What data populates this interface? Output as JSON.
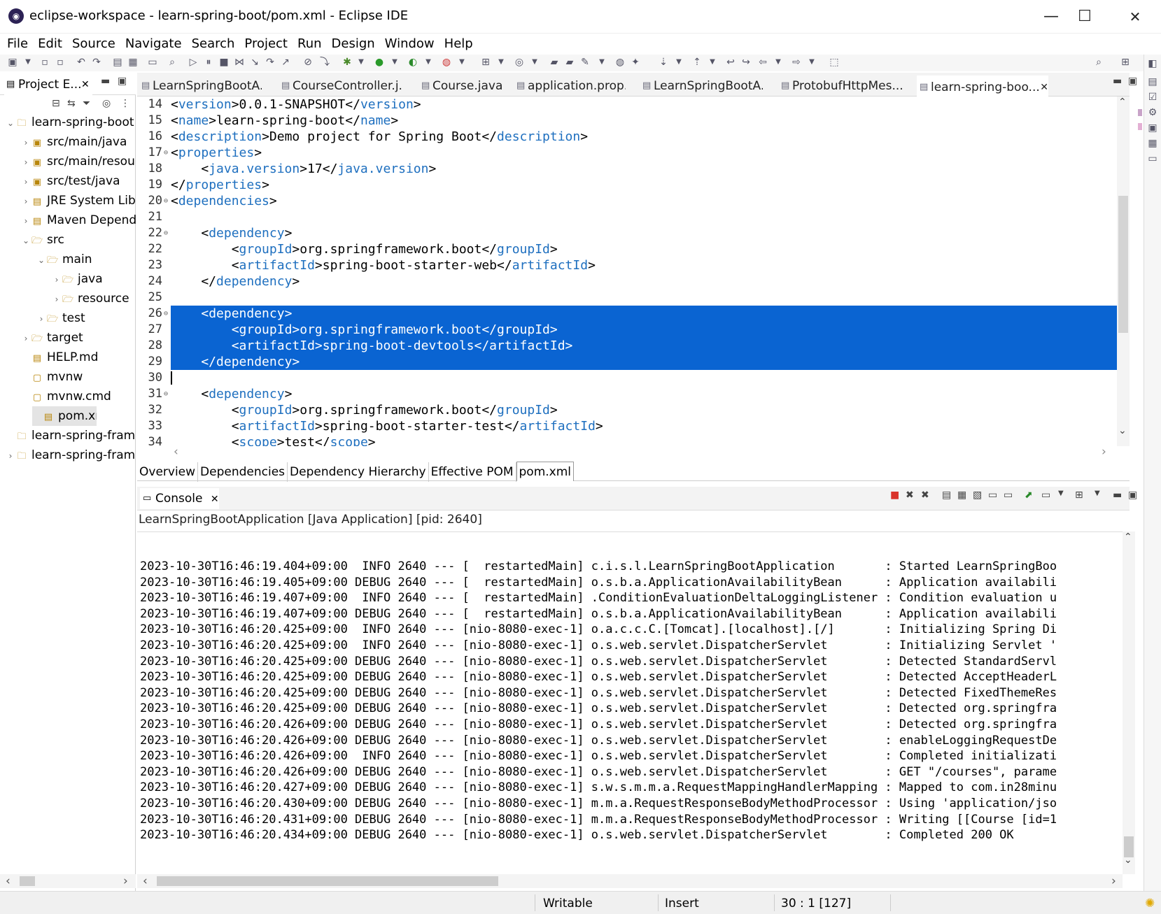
{
  "window": {
    "title": "eclipse-workspace - learn-spring-boot/pom.xml - Eclipse IDE",
    "minimize": "—",
    "maximize": "☐",
    "close": "✕"
  },
  "menu": [
    "File",
    "Edit",
    "Source",
    "Navigate",
    "Search",
    "Project",
    "Run",
    "Design",
    "Window",
    "Help"
  ],
  "project_explorer": {
    "tab_label": "Project E...",
    "tree": [
      {
        "label": "learn-spring-boot",
        "arrow": "⌄",
        "icon": "🗀"
      },
      {
        "label": "src/main/java",
        "arrow": "›",
        "icon": "▣"
      },
      {
        "label": "src/main/resou",
        "arrow": "›",
        "icon": "▣"
      },
      {
        "label": "src/test/java",
        "arrow": "›",
        "icon": "▣"
      },
      {
        "label": "JRE System Lib",
        "arrow": "›",
        "icon": "▤"
      },
      {
        "label": "Maven Depend",
        "arrow": "›",
        "icon": "▤"
      },
      {
        "label": "src",
        "arrow": "⌄",
        "icon": "🗁"
      },
      {
        "label": "main",
        "arrow": "⌄",
        "icon": "🗁"
      },
      {
        "label": "java",
        "arrow": "›",
        "icon": "🗁"
      },
      {
        "label": "resource",
        "arrow": "›",
        "icon": "🗁"
      },
      {
        "label": "test",
        "arrow": "›",
        "icon": "🗁"
      },
      {
        "label": "target",
        "arrow": "›",
        "icon": "🗁"
      },
      {
        "label": "HELP.md",
        "arrow": "",
        "icon": "▤"
      },
      {
        "label": "mvnw",
        "arrow": "",
        "icon": "▢"
      },
      {
        "label": "mvnw.cmd",
        "arrow": "",
        "icon": "▢"
      },
      {
        "label": "pom.xml",
        "arrow": "",
        "icon": "▤"
      },
      {
        "label": "learn-spring-frame",
        "arrow": "",
        "icon": "🗀"
      },
      {
        "label": "learn-spring-frame",
        "arrow": "›",
        "icon": "🗀"
      }
    ]
  },
  "editor_tabs": [
    "LearnSpringBootA...",
    "CourseController.j...",
    "Course.java",
    "application.prop...",
    "LearnSpringBootA...",
    "ProtobufHttpMes...",
    "learn-spring-boo..."
  ],
  "code_lines": [
    {
      "n": "14",
      "fold": "",
      "code": "<version>0.0.1-SNAPSHOT</version>"
    },
    {
      "n": "15",
      "fold": "",
      "code": "<name>learn-spring-boot</name>"
    },
    {
      "n": "16",
      "fold": "",
      "code": "<description>Demo project for Spring Boot</description>"
    },
    {
      "n": "17",
      "fold": "⊖",
      "code": "<properties>"
    },
    {
      "n": "18",
      "fold": "",
      "code": "    <java.version>17</java.version>"
    },
    {
      "n": "19",
      "fold": "",
      "code": "</properties>"
    },
    {
      "n": "20",
      "fold": "⊖",
      "code": "<dependencies>"
    },
    {
      "n": "21",
      "fold": "",
      "code": ""
    },
    {
      "n": "22",
      "fold": "⊖",
      "code": "    <dependency>"
    },
    {
      "n": "22",
      "fold": "",
      "code": "        <groupId>org.springframework.boot</groupId>"
    },
    {
      "n": "23",
      "fold": "",
      "code": "        <artifactId>spring-boot-starter-web</artifactId>"
    },
    {
      "n": "24",
      "fold": "",
      "code": "    </dependency>"
    },
    {
      "n": "25",
      "fold": "",
      "code": ""
    },
    {
      "n": "26",
      "fold": "⊖",
      "code": "    <dependency>"
    },
    {
      "n": "27",
      "fold": "",
      "code": "        <groupId>org.springframework.boot</groupId>"
    },
    {
      "n": "28",
      "fold": "",
      "code": "        <artifactId>spring-boot-devtools</artifactId>"
    },
    {
      "n": "29",
      "fold": "",
      "code": "    </dependency>"
    },
    {
      "n": "30",
      "fold": "",
      "code": ""
    },
    {
      "n": "31",
      "fold": "⊖",
      "code": "    <dependency>"
    },
    {
      "n": "32",
      "fold": "",
      "code": "        <groupId>org.springframework.boot</groupId>"
    },
    {
      "n": "33",
      "fold": "",
      "code": "        <artifactId>spring-boot-starter-test</artifactId>"
    },
    {
      "n": "34",
      "fold": "",
      "code": "        <scope>test</scope>"
    }
  ],
  "selected_lines": [
    "26",
    "27",
    "28",
    "29"
  ],
  "pom_tabs": [
    "Overview",
    "Dependencies",
    "Dependency Hierarchy",
    "Effective POM",
    "pom.xml"
  ],
  "console": {
    "tab_label": "Console",
    "process": "LearnSpringBootApplication [Java Application]   [pid: 2640]",
    "lines": [
      "2023-10-30T16:46:19.404+09:00  INFO 2640 --- [  restartedMain] c.i.s.l.LearnSpringBootApplication       : Started LearnSpringBoo",
      "2023-10-30T16:46:19.405+09:00 DEBUG 2640 --- [  restartedMain] o.s.b.a.ApplicationAvailabilityBean      : Application availabili",
      "2023-10-30T16:46:19.407+09:00  INFO 2640 --- [  restartedMain] .ConditionEvaluationDeltaLoggingListener : Condition evaluation u",
      "2023-10-30T16:46:19.407+09:00 DEBUG 2640 --- [  restartedMain] o.s.b.a.ApplicationAvailabilityBean      : Application availabili",
      "2023-10-30T16:46:20.425+09:00  INFO 2640 --- [nio-8080-exec-1] o.a.c.c.C.[Tomcat].[localhost].[/]       : Initializing Spring Di",
      "2023-10-30T16:46:20.425+09:00  INFO 2640 --- [nio-8080-exec-1] o.s.web.servlet.DispatcherServlet        : Initializing Servlet '",
      "2023-10-30T16:46:20.425+09:00 DEBUG 2640 --- [nio-8080-exec-1] o.s.web.servlet.DispatcherServlet        : Detected StandardServl",
      "2023-10-30T16:46:20.425+09:00 DEBUG 2640 --- [nio-8080-exec-1] o.s.web.servlet.DispatcherServlet        : Detected AcceptHeaderL",
      "2023-10-30T16:46:20.425+09:00 DEBUG 2640 --- [nio-8080-exec-1] o.s.web.servlet.DispatcherServlet        : Detected FixedThemeRes",
      "2023-10-30T16:46:20.425+09:00 DEBUG 2640 --- [nio-8080-exec-1] o.s.web.servlet.DispatcherServlet        : Detected org.springfra",
      "2023-10-30T16:46:20.426+09:00 DEBUG 2640 --- [nio-8080-exec-1] o.s.web.servlet.DispatcherServlet        : Detected org.springfra",
      "2023-10-30T16:46:20.426+09:00 DEBUG 2640 --- [nio-8080-exec-1] o.s.web.servlet.DispatcherServlet        : enableLoggingRequestDe",
      "2023-10-30T16:46:20.426+09:00  INFO 2640 --- [nio-8080-exec-1] o.s.web.servlet.DispatcherServlet        : Completed initializati",
      "2023-10-30T16:46:20.426+09:00 DEBUG 2640 --- [nio-8080-exec-1] o.s.web.servlet.DispatcherServlet        : GET \"/courses\", parame",
      "2023-10-30T16:46:20.427+09:00 DEBUG 2640 --- [nio-8080-exec-1] s.w.s.m.m.a.RequestMappingHandlerMapping : Mapped to com.in28minu",
      "2023-10-30T16:46:20.430+09:00 DEBUG 2640 --- [nio-8080-exec-1] m.m.a.RequestResponseBodyMethodProcessor : Using 'application/jso",
      "2023-10-30T16:46:20.431+09:00 DEBUG 2640 --- [nio-8080-exec-1] m.m.a.RequestResponseBodyMethodProcessor : Writing [[Course [id=1",
      "2023-10-30T16:46:20.434+09:00 DEBUG 2640 --- [nio-8080-exec-1] o.s.web.servlet.DispatcherServlet        : Completed 200 OK"
    ]
  },
  "status": {
    "writable": "Writable",
    "insert": "Insert",
    "position": "30 : 1 [127]"
  },
  "colors": {
    "selection": "#0a64d2",
    "xml_tag": "#1e6fbf",
    "stop_button": "#d9342b"
  }
}
